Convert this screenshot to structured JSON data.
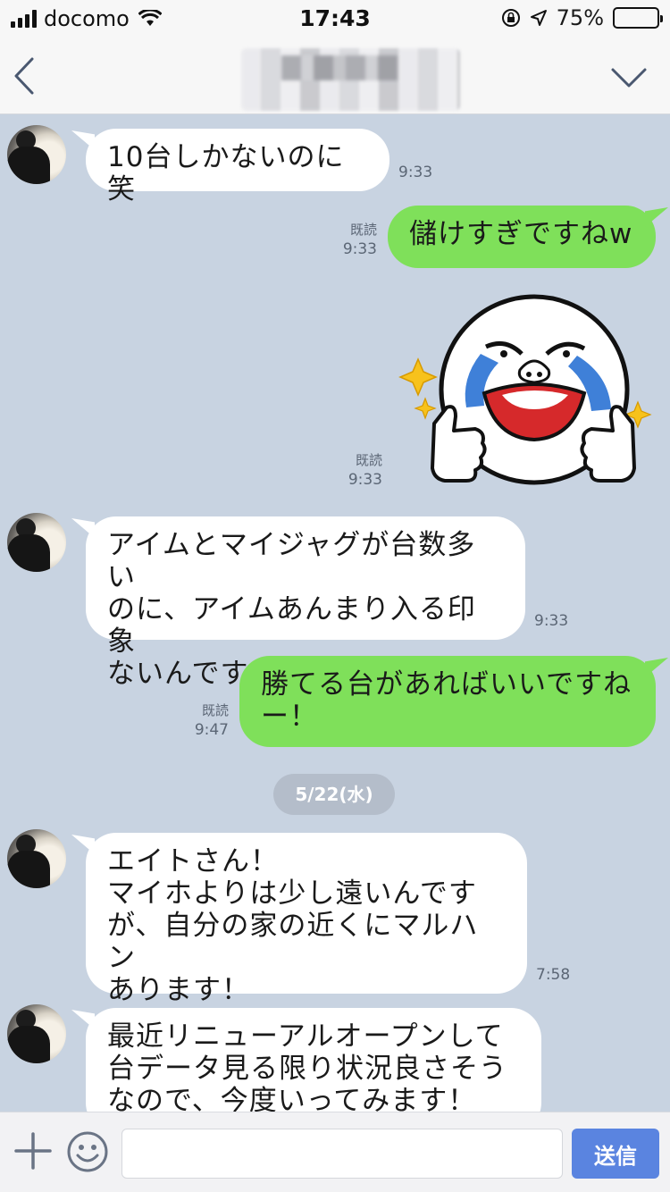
{
  "status_bar": {
    "carrier": "docomo",
    "time": "17:43",
    "battery": "75%",
    "battery_level": 0.75
  },
  "nav": {
    "back_icon": "chevron-left-icon",
    "menu_icon": "chevron-down-icon"
  },
  "messages": [
    {
      "side": "in",
      "text": "10台しかないのに笑",
      "time": "9:33"
    },
    {
      "side": "out",
      "text": "儲けすぎですねw",
      "read": "既読",
      "time": "9:33"
    },
    {
      "side": "out-sticker",
      "sticker": "crying-laughing-moon-thumbs-up-sticker",
      "read": "既読",
      "time": "9:33"
    },
    {
      "side": "in",
      "text": "アイムとマイジャグが台数多い\nのに、アイムあんまり入る印象\nないんですよね、、",
      "time": "9:33"
    },
    {
      "side": "out",
      "text": "勝てる台があればいいですね\nー！",
      "read": "既読",
      "time": "9:47"
    },
    {
      "side": "in",
      "text": "エイトさん！\nマイホよりは少し遠いんです\nが、自分の家の近くにマルハン\nあります！",
      "time": "7:58"
    },
    {
      "side": "in",
      "text": "最近リニューアルオープンして\n台データ見る限り状況良さそう\nなので、今度いってみます！",
      "time": ""
    }
  ],
  "date_divider": "5/22(水)",
  "input_bar": {
    "placeholder": "",
    "send_label": "送信",
    "plus_icon": "plus-icon",
    "emoji_icon": "smiley-icon"
  },
  "colors": {
    "chat_bg": "#c8d3e1",
    "outgoing_bubble": "#7fe05a",
    "incoming_bubble": "#ffffff",
    "send_button": "#5a84e0"
  }
}
